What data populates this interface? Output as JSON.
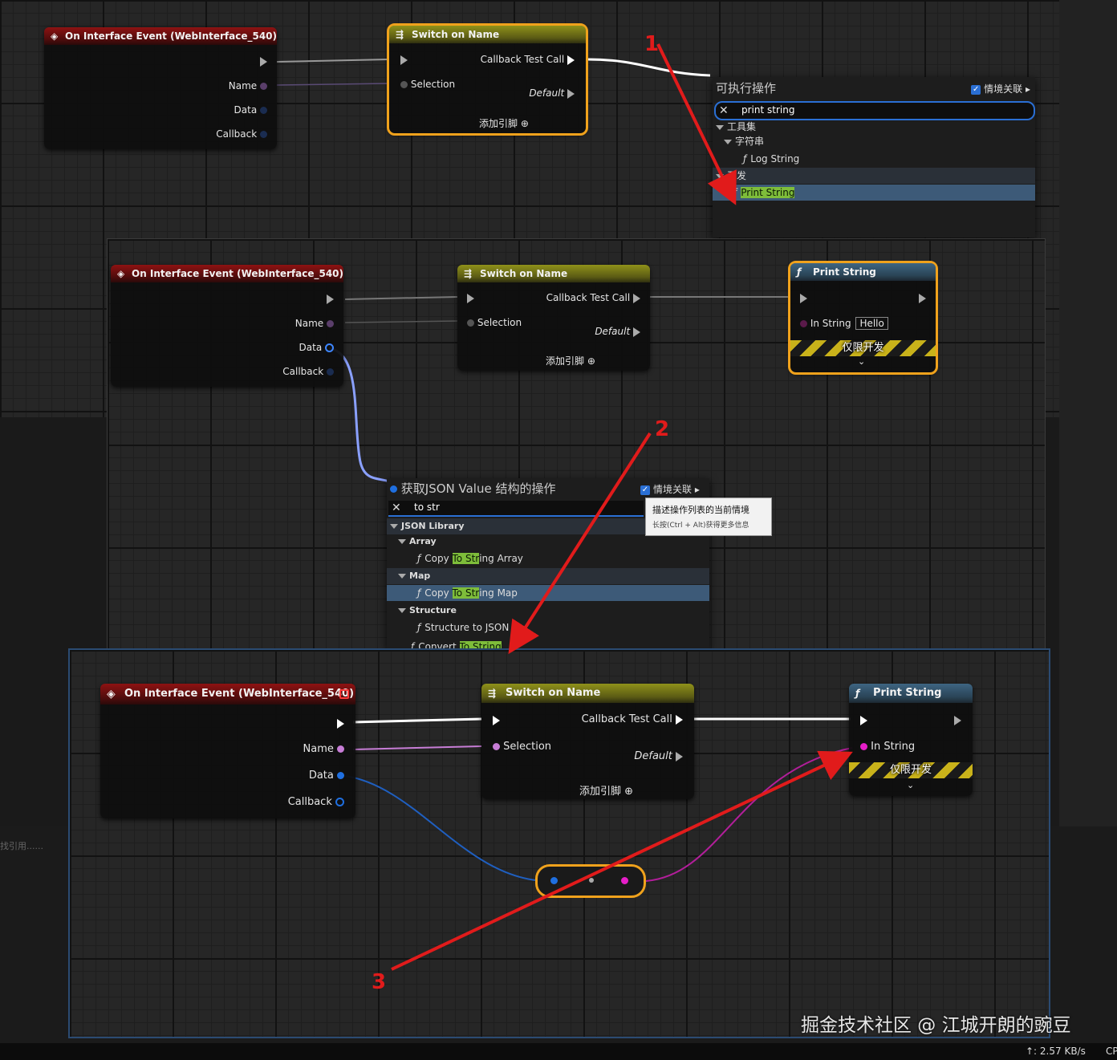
{
  "panel1": {
    "event_node": {
      "title": "On Interface Event (WebInterface_540)",
      "pins": [
        "Name",
        "Data",
        "Callback"
      ]
    },
    "switch_node": {
      "title": "Switch on Name",
      "out_pin": "Callback Test Call",
      "in_pin": "Selection",
      "default_pin": "Default",
      "add_pin": "添加引脚"
    },
    "action_menu": {
      "title": "可执行操作",
      "context_label": "情境关联",
      "search_value": "print string",
      "categories": [
        {
          "label": "工具集",
          "sub": [
            {
              "label": "字符串",
              "items": [
                "Log String"
              ]
            }
          ]
        },
        {
          "label": "开发",
          "items_pre": "",
          "items_hl": "Print String"
        }
      ]
    }
  },
  "panel2": {
    "event_node": {
      "title": "On Interface Event (WebInterface_540)",
      "pins": [
        "Name",
        "Data",
        "Callback"
      ]
    },
    "switch_node": {
      "title": "Switch on Name",
      "out_pin": "Callback Test Call",
      "in_pin": "Selection",
      "default_pin": "Default",
      "add_pin": "添加引脚"
    },
    "print_node": {
      "title": "Print String",
      "in_string_label": "In String",
      "in_string_value": "Hello",
      "dev_only": "仅限开发"
    },
    "json_menu": {
      "title": "获取JSON Value 结构的操作",
      "context_label": "情境关联",
      "search_value": "to str",
      "tooltip_title": "描述操作列表的当前情境",
      "tooltip_hint": "长按(Ctrl + Alt)获得更多信息",
      "library": "JSON Library",
      "groups": [
        {
          "label": "Array",
          "item_pre": "Copy ",
          "item_hl1": "To Str",
          "item_post": "ing Array"
        },
        {
          "label": "Map",
          "item_pre": "Copy ",
          "item_hl1": "To Str",
          "item_post": "ing Map"
        },
        {
          "label": "Structure",
          "item_pre": "Structure to JSON",
          "item_hl1": "",
          "item_post": ""
        }
      ],
      "last_item_pre": "Convert ",
      "last_item_hl": "To String"
    }
  },
  "panel3": {
    "event_node": {
      "title": "On Interface Event (WebInterface_540)",
      "pins": [
        "Name",
        "Data",
        "Callback"
      ]
    },
    "switch_node": {
      "title": "Switch on Name",
      "out_pin": "Callback Test Call",
      "in_pin": "Selection",
      "default_pin": "Default",
      "add_pin": "添加引脚"
    },
    "print_node": {
      "title": "Print String",
      "in_string_label": "In String",
      "dev_only": "仅限开发"
    }
  },
  "annotations": {
    "one": "1",
    "two": "2",
    "three": "3"
  },
  "watermark": "掘金技术社区 @ 江城开朗的豌豆",
  "status": {
    "speed": "↑: 2.57 KB/s",
    "cpu": "CP",
    "left_text": "找引用......"
  },
  "colors": {
    "arrow": "#e11b1b",
    "selection": "#f0a21c",
    "event_header": "#8e1212",
    "switch_header": "#8f911a",
    "print_header": "#3e6582",
    "string_pin": "#e61ec8",
    "struct_pin": "#1f6fe0",
    "name_pin": "#c77dd6"
  }
}
